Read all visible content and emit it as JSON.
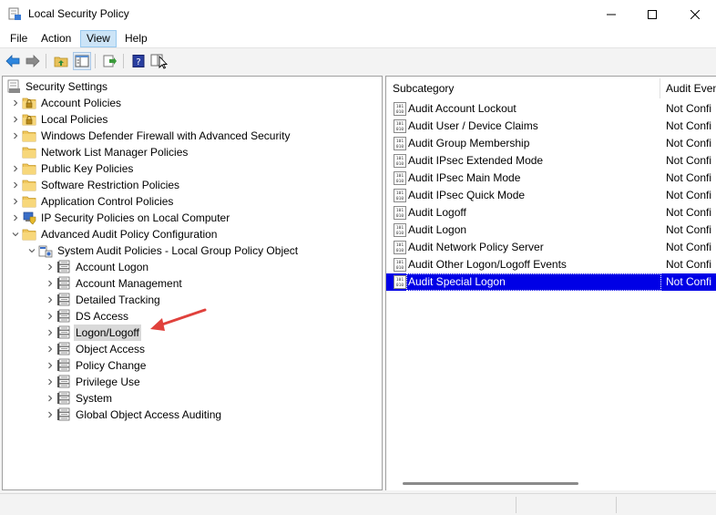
{
  "window": {
    "title": "Local Security Policy"
  },
  "menu": [
    "File",
    "Action",
    "View",
    "Help"
  ],
  "menu_active": "View",
  "tree": [
    {
      "label": "Security Settings",
      "icon": "computer-settings-icon"
    },
    {
      "label": "Account Policies",
      "icon": "folder-lock-icon"
    },
    {
      "label": "Local Policies",
      "icon": "folder-lock-icon"
    },
    {
      "label": "Windows Defender Firewall with Advanced Security",
      "icon": "folder-icon"
    },
    {
      "label": "Network List Manager Policies",
      "icon": "folder-icon"
    },
    {
      "label": "Public Key Policies",
      "icon": "folder-icon"
    },
    {
      "label": "Software Restriction Policies",
      "icon": "folder-icon"
    },
    {
      "label": "Application Control Policies",
      "icon": "folder-icon"
    },
    {
      "label": "IP Security Policies on Local Computer",
      "icon": "ip-security-icon"
    },
    {
      "label": "Advanced Audit Policy Configuration",
      "icon": "folder-icon"
    },
    {
      "label": "System Audit Policies - Local Group Policy Object",
      "icon": "policy-object-icon"
    },
    {
      "label": "Account Logon",
      "icon": "policy-icon"
    },
    {
      "label": "Account Management",
      "icon": "policy-icon"
    },
    {
      "label": "Detailed Tracking",
      "icon": "policy-icon"
    },
    {
      "label": "DS Access",
      "icon": "policy-icon"
    },
    {
      "label": "Logon/Logoff",
      "icon": "policy-icon"
    },
    {
      "label": "Object Access",
      "icon": "policy-icon"
    },
    {
      "label": "Policy Change",
      "icon": "policy-icon"
    },
    {
      "label": "Privilege Use",
      "icon": "policy-icon"
    },
    {
      "label": "System",
      "icon": "policy-icon"
    },
    {
      "label": "Global Object Access Auditing",
      "icon": "policy-icon"
    }
  ],
  "tree_selected": "Logon/Logoff",
  "list": {
    "columns": [
      "Subcategory",
      "Audit Even"
    ],
    "rows": [
      {
        "name": "Audit Account Lockout",
        "value": "Not Confi"
      },
      {
        "name": "Audit User / Device Claims",
        "value": "Not Confi"
      },
      {
        "name": "Audit Group Membership",
        "value": "Not Confi"
      },
      {
        "name": "Audit IPsec Extended Mode",
        "value": "Not Confi"
      },
      {
        "name": "Audit IPsec Main Mode",
        "value": "Not Confi"
      },
      {
        "name": "Audit IPsec Quick Mode",
        "value": "Not Confi"
      },
      {
        "name": "Audit Logoff",
        "value": "Not Confi"
      },
      {
        "name": "Audit Logon",
        "value": "Not Confi"
      },
      {
        "name": "Audit Network Policy Server",
        "value": "Not Confi"
      },
      {
        "name": "Audit Other Logon/Logoff Events",
        "value": "Not Confi"
      },
      {
        "name": "Audit Special Logon",
        "value": "Not Confi"
      }
    ],
    "selected": "Audit Special Logon"
  },
  "colors": {
    "selection": "#0000e6",
    "tree_selection": "#d9d9d9",
    "annotation_arrow": "#e0413c"
  }
}
